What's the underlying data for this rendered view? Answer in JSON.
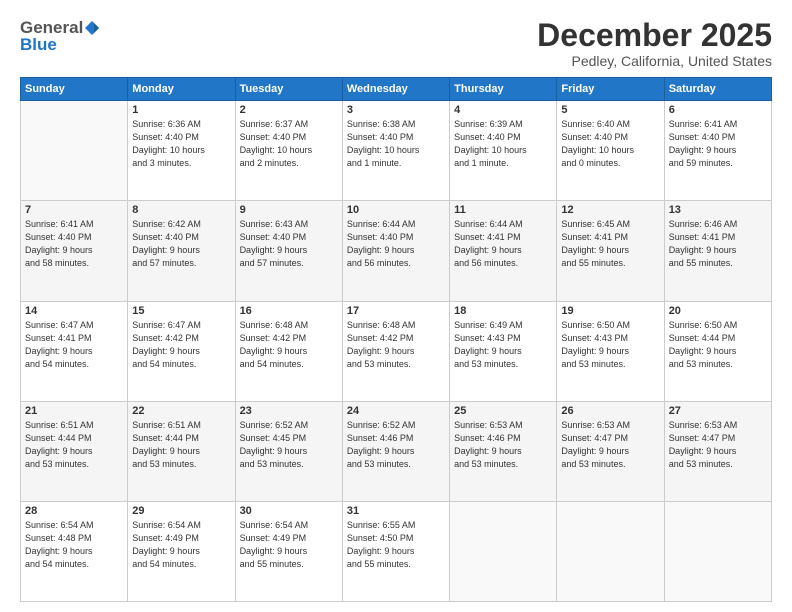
{
  "logo": {
    "general": "General",
    "blue": "Blue"
  },
  "title": "December 2025",
  "location": "Pedley, California, United States",
  "weekdays": [
    "Sunday",
    "Monday",
    "Tuesday",
    "Wednesday",
    "Thursday",
    "Friday",
    "Saturday"
  ],
  "weeks": [
    [
      {
        "day": "",
        "info": ""
      },
      {
        "day": "1",
        "info": "Sunrise: 6:36 AM\nSunset: 4:40 PM\nDaylight: 10 hours\nand 3 minutes."
      },
      {
        "day": "2",
        "info": "Sunrise: 6:37 AM\nSunset: 4:40 PM\nDaylight: 10 hours\nand 2 minutes."
      },
      {
        "day": "3",
        "info": "Sunrise: 6:38 AM\nSunset: 4:40 PM\nDaylight: 10 hours\nand 1 minute."
      },
      {
        "day": "4",
        "info": "Sunrise: 6:39 AM\nSunset: 4:40 PM\nDaylight: 10 hours\nand 1 minute."
      },
      {
        "day": "5",
        "info": "Sunrise: 6:40 AM\nSunset: 4:40 PM\nDaylight: 10 hours\nand 0 minutes."
      },
      {
        "day": "6",
        "info": "Sunrise: 6:41 AM\nSunset: 4:40 PM\nDaylight: 9 hours\nand 59 minutes."
      }
    ],
    [
      {
        "day": "7",
        "info": "Sunrise: 6:41 AM\nSunset: 4:40 PM\nDaylight: 9 hours\nand 58 minutes."
      },
      {
        "day": "8",
        "info": "Sunrise: 6:42 AM\nSunset: 4:40 PM\nDaylight: 9 hours\nand 57 minutes."
      },
      {
        "day": "9",
        "info": "Sunrise: 6:43 AM\nSunset: 4:40 PM\nDaylight: 9 hours\nand 57 minutes."
      },
      {
        "day": "10",
        "info": "Sunrise: 6:44 AM\nSunset: 4:40 PM\nDaylight: 9 hours\nand 56 minutes."
      },
      {
        "day": "11",
        "info": "Sunrise: 6:44 AM\nSunset: 4:41 PM\nDaylight: 9 hours\nand 56 minutes."
      },
      {
        "day": "12",
        "info": "Sunrise: 6:45 AM\nSunset: 4:41 PM\nDaylight: 9 hours\nand 55 minutes."
      },
      {
        "day": "13",
        "info": "Sunrise: 6:46 AM\nSunset: 4:41 PM\nDaylight: 9 hours\nand 55 minutes."
      }
    ],
    [
      {
        "day": "14",
        "info": "Sunrise: 6:47 AM\nSunset: 4:41 PM\nDaylight: 9 hours\nand 54 minutes."
      },
      {
        "day": "15",
        "info": "Sunrise: 6:47 AM\nSunset: 4:42 PM\nDaylight: 9 hours\nand 54 minutes."
      },
      {
        "day": "16",
        "info": "Sunrise: 6:48 AM\nSunset: 4:42 PM\nDaylight: 9 hours\nand 54 minutes."
      },
      {
        "day": "17",
        "info": "Sunrise: 6:48 AM\nSunset: 4:42 PM\nDaylight: 9 hours\nand 53 minutes."
      },
      {
        "day": "18",
        "info": "Sunrise: 6:49 AM\nSunset: 4:43 PM\nDaylight: 9 hours\nand 53 minutes."
      },
      {
        "day": "19",
        "info": "Sunrise: 6:50 AM\nSunset: 4:43 PM\nDaylight: 9 hours\nand 53 minutes."
      },
      {
        "day": "20",
        "info": "Sunrise: 6:50 AM\nSunset: 4:44 PM\nDaylight: 9 hours\nand 53 minutes."
      }
    ],
    [
      {
        "day": "21",
        "info": "Sunrise: 6:51 AM\nSunset: 4:44 PM\nDaylight: 9 hours\nand 53 minutes."
      },
      {
        "day": "22",
        "info": "Sunrise: 6:51 AM\nSunset: 4:44 PM\nDaylight: 9 hours\nand 53 minutes."
      },
      {
        "day": "23",
        "info": "Sunrise: 6:52 AM\nSunset: 4:45 PM\nDaylight: 9 hours\nand 53 minutes."
      },
      {
        "day": "24",
        "info": "Sunrise: 6:52 AM\nSunset: 4:46 PM\nDaylight: 9 hours\nand 53 minutes."
      },
      {
        "day": "25",
        "info": "Sunrise: 6:53 AM\nSunset: 4:46 PM\nDaylight: 9 hours\nand 53 minutes."
      },
      {
        "day": "26",
        "info": "Sunrise: 6:53 AM\nSunset: 4:47 PM\nDaylight: 9 hours\nand 53 minutes."
      },
      {
        "day": "27",
        "info": "Sunrise: 6:53 AM\nSunset: 4:47 PM\nDaylight: 9 hours\nand 53 minutes."
      }
    ],
    [
      {
        "day": "28",
        "info": "Sunrise: 6:54 AM\nSunset: 4:48 PM\nDaylight: 9 hours\nand 54 minutes."
      },
      {
        "day": "29",
        "info": "Sunrise: 6:54 AM\nSunset: 4:49 PM\nDaylight: 9 hours\nand 54 minutes."
      },
      {
        "day": "30",
        "info": "Sunrise: 6:54 AM\nSunset: 4:49 PM\nDaylight: 9 hours\nand 55 minutes."
      },
      {
        "day": "31",
        "info": "Sunrise: 6:55 AM\nSunset: 4:50 PM\nDaylight: 9 hours\nand 55 minutes."
      },
      {
        "day": "",
        "info": ""
      },
      {
        "day": "",
        "info": ""
      },
      {
        "day": "",
        "info": ""
      }
    ]
  ]
}
